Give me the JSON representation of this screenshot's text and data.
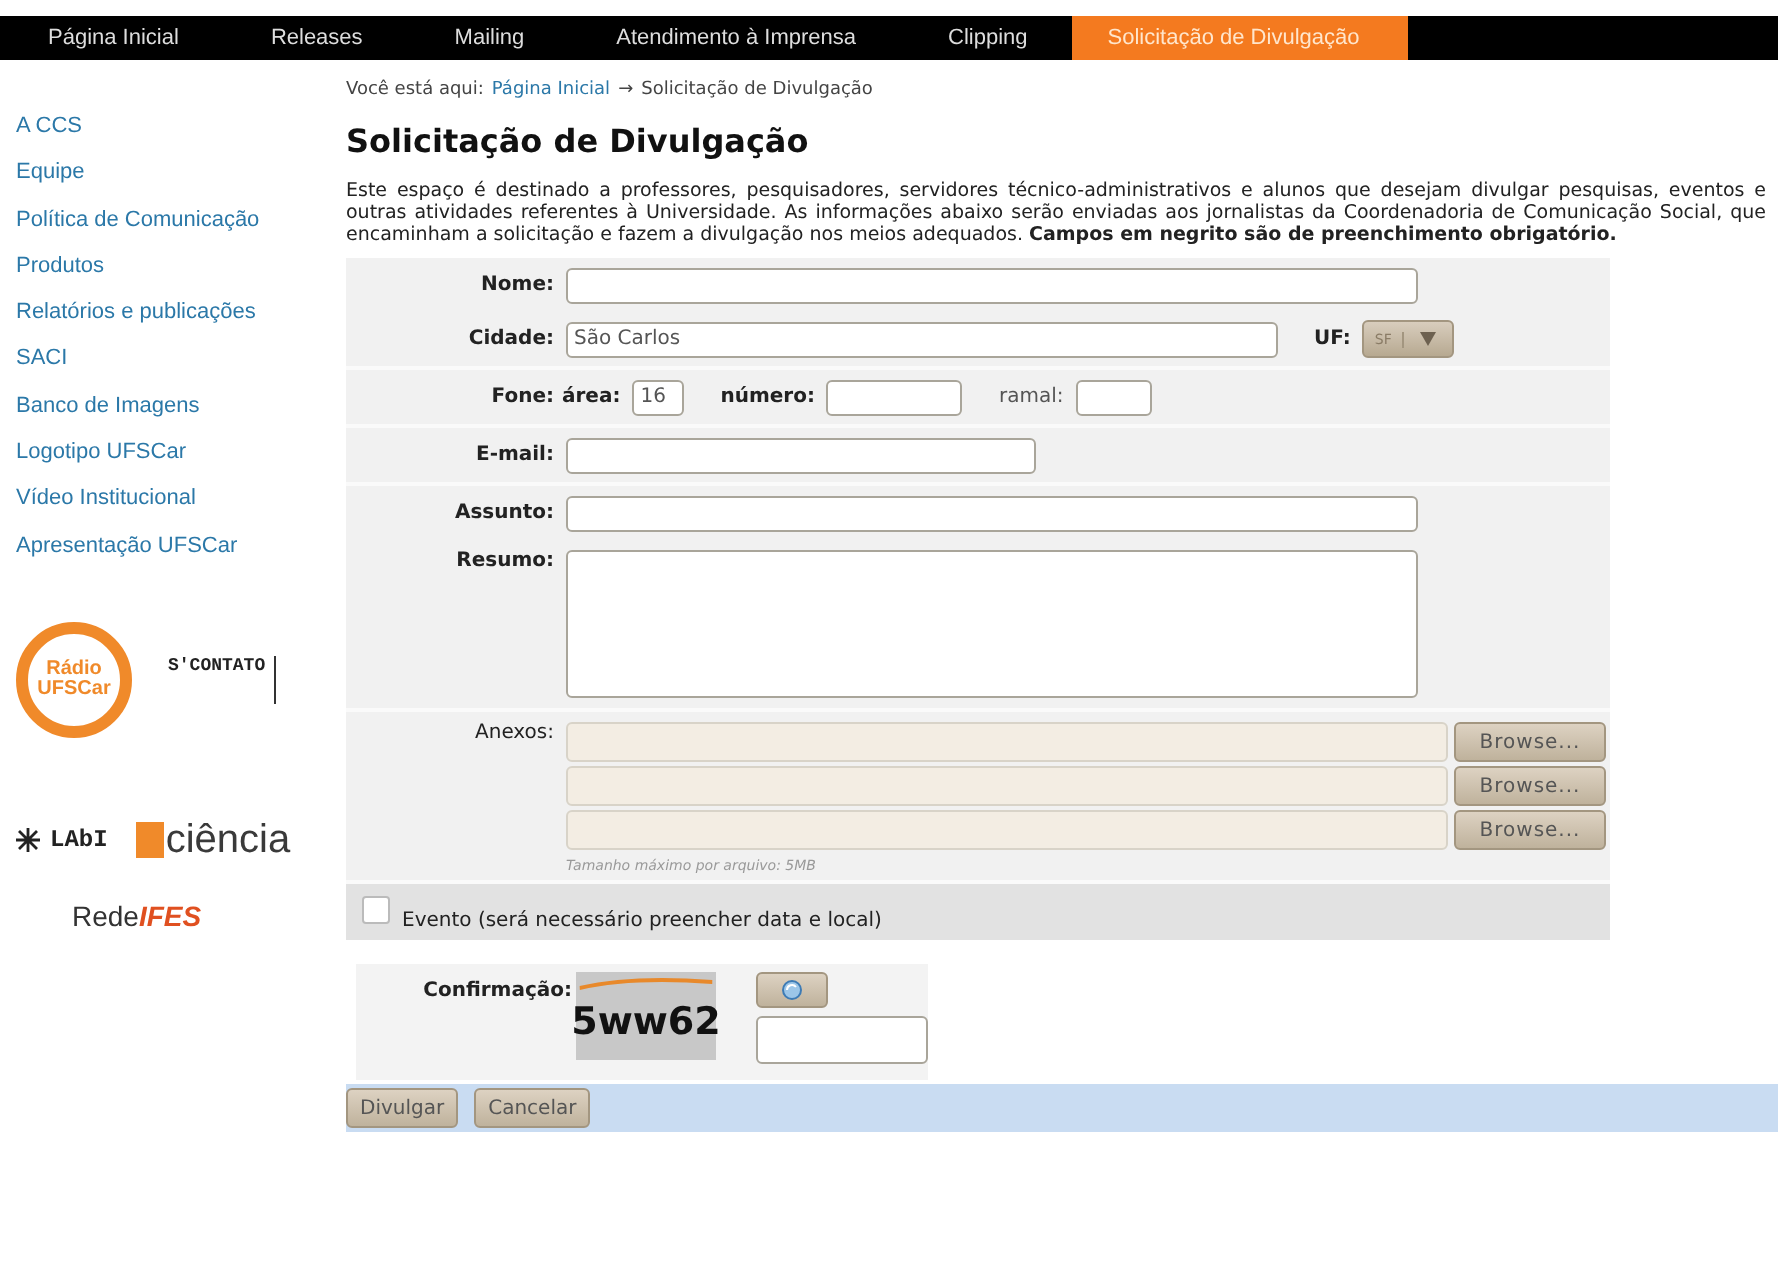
{
  "nav": [
    {
      "label": "Página Inicial",
      "selected": false
    },
    {
      "label": "Releases",
      "selected": false
    },
    {
      "label": "Mailing",
      "selected": false
    },
    {
      "label": "Atendimento à Imprensa",
      "selected": false
    },
    {
      "label": "Clipping",
      "selected": false
    },
    {
      "label": "Solicitação de Divulgação",
      "selected": true
    }
  ],
  "sidebar": {
    "items": [
      "A CCS",
      "Equipe",
      "Política de Comunicação",
      "Produtos",
      "Relatórios e publicações",
      "SACI",
      "Banco de Imagens",
      "Logotipo UFSCar",
      "Vídeo Institucional",
      "Apresentação UFSCar"
    ],
    "logos": {
      "radio": [
        "Rádio",
        "UFSCar"
      ],
      "contato": "S'CONTATO",
      "labi": "LAbI",
      "ciencia": "ciência",
      "rede": [
        "Rede",
        "IFES"
      ]
    }
  },
  "breadcrumb": {
    "prefix": "Você está aqui:",
    "link": "Página Inicial",
    "arrow": "→",
    "current": "Solicitação de Divulgação"
  },
  "title": "Solicitação de Divulgação",
  "intro": "Este espaço é destinado a professores, pesquisadores, servidores técnico-administrativos e alunos que desejam divulgar pesquisas, eventos e outras atividades referentes à Universidade. As informações abaixo serão enviadas aos jornalistas da Coordenadoria de Comunicação Social, que encaminham a solicitação e fazem a divulgação nos meios adequados. **Campos em negrito são de preenchimento obrigatório.**",
  "form": {
    "nome": {
      "label": "Nome:",
      "required": true
    },
    "cidade": {
      "label": "Cidade:",
      "required": true,
      "value": "São Carlos",
      "uf_label": "UF:",
      "uf_value": "SF"
    },
    "fone": {
      "label": "Fone:",
      "required": true,
      "area_label": "área:",
      "area_value": "16",
      "numero_label": "número:",
      "ramal_label": "ramal:"
    },
    "email": {
      "label": "E-mail:",
      "required": true
    },
    "assunto": {
      "label": "Assunto:",
      "required": true
    },
    "resumo": {
      "label": "Resumo:",
      "required": true
    },
    "anexos": {
      "label": "Anexos:",
      "required": false,
      "buttons": [
        "Browse...",
        "Browse...",
        "Browse..."
      ],
      "note": "Tamanho máximo por arquivo: 5MB"
    },
    "evento": {
      "label": "Evento (será necessário preencher data e local)",
      "checked": false
    },
    "confirmacao": {
      "label": "Confirmação:",
      "captcha": "5ww62"
    }
  },
  "buttons": [
    "Divulgar",
    "Cancelar"
  ]
}
